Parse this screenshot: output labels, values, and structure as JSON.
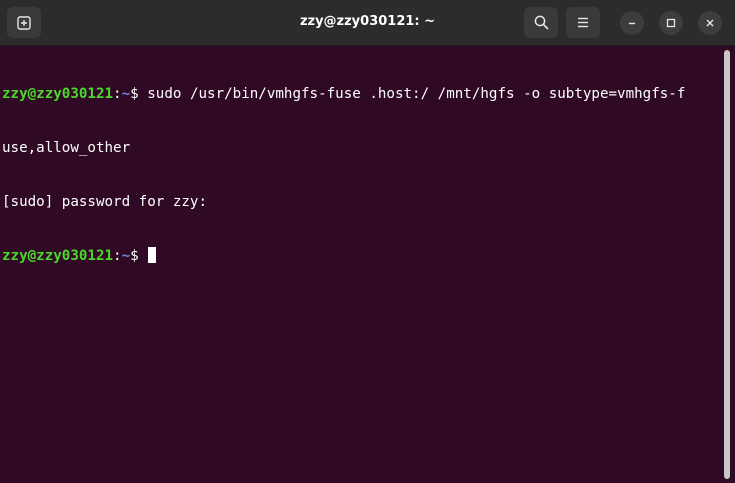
{
  "window": {
    "title": "zzy@zzy030121: ~"
  },
  "titlebar": {
    "icons": {
      "new_tab": "new-tab-icon",
      "search": "search-icon",
      "menu": "hamburger-menu-icon",
      "minimize": "minimize-icon",
      "maximize": "maximize-icon",
      "close": "close-icon"
    }
  },
  "terminal": {
    "line1": {
      "user_host": "zzy@zzy030121",
      "colon": ":",
      "path": "~",
      "prompt": "$ ",
      "command": "sudo /usr/bin/vmhgfs-fuse .host:/ /mnt/hgfs -o subtype=vmhgfs-f"
    },
    "line2": {
      "text": "use,allow_other"
    },
    "line3": {
      "text": "[sudo] password for zzy:"
    },
    "line4": {
      "user_host": "zzy@zzy030121",
      "colon": ":",
      "path": "~",
      "prompt": "$ "
    }
  },
  "colors": {
    "terminal_bg": "#300a24",
    "user_host": "#4bd82a",
    "path": "#6b86e6",
    "titlebar_bg": "#2c2c2c"
  }
}
